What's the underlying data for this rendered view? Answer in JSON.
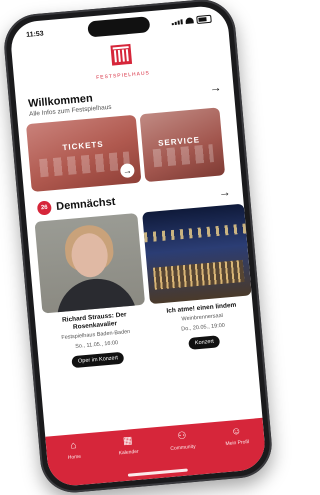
{
  "status": {
    "time": "11:53"
  },
  "brand": {
    "logo_text": "FESTSPIELHAUS"
  },
  "welcome": {
    "title": "Willkommen",
    "subtitle": "Alle Infos zum Festspielhaus"
  },
  "tiles": [
    {
      "label": "TICKETS"
    },
    {
      "label": "SERVICE"
    }
  ],
  "upcoming": {
    "badge": "26",
    "title": "Demnächst",
    "events": [
      {
        "title": "Richard Strauss: Der Rosenkavalier",
        "venue": "Festspielhaus Baden-Baden",
        "date": "So., 11.05., 16:00",
        "tag": "Oper im Konzert"
      },
      {
        "title": "Ich atme! einen lindem",
        "venue": "Weinbrennersaal",
        "date": "Do., 20.05., 19:00",
        "tag": "Konzert"
      }
    ]
  },
  "tabbar": {
    "items": [
      {
        "label": "Home"
      },
      {
        "label": "Kalender"
      },
      {
        "label": "Community"
      },
      {
        "label": "Mein Profil"
      }
    ]
  },
  "colors": {
    "brand_red": "#d6263a",
    "tile_red": "#b0594f"
  }
}
